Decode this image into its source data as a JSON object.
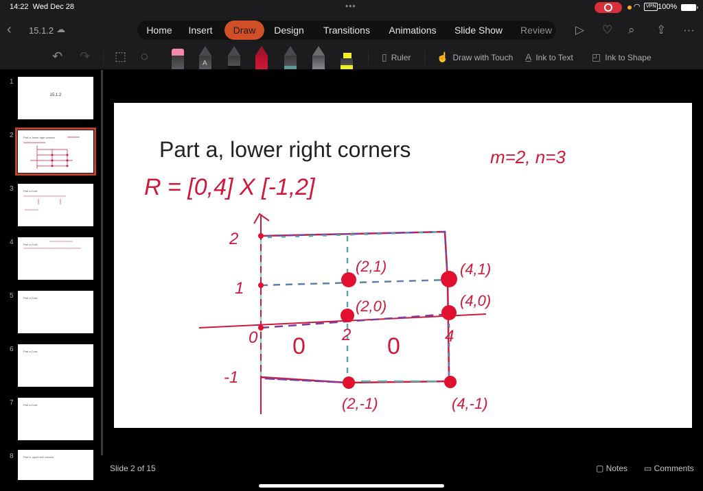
{
  "status_bar": {
    "time": "14:22",
    "date": "Wed Dec 28",
    "multitask_dots": "•••",
    "vpn_label": "VPN",
    "battery_percent": "100%"
  },
  "ribbon": {
    "document_name": "15.1.2",
    "tabs": [
      {
        "label": "Home",
        "active": false
      },
      {
        "label": "Insert",
        "active": false
      },
      {
        "label": "Draw",
        "active": true
      },
      {
        "label": "Design",
        "active": false
      },
      {
        "label": "Transitions",
        "active": false
      },
      {
        "label": "Animations",
        "active": false
      },
      {
        "label": "Slide Show",
        "active": false
      },
      {
        "label": "Review",
        "active": false
      }
    ],
    "icons": [
      "play-icon",
      "lightbulb-icon",
      "search-icon",
      "share-icon",
      "more-icon"
    ]
  },
  "draw_toolbar": {
    "pens": [
      {
        "name": "eraser",
        "color": "#f28cab"
      },
      {
        "name": "action-pen",
        "color": "#6a6a6e"
      },
      {
        "name": "black-pen",
        "color": "#111111"
      },
      {
        "name": "red-pen",
        "color": "#d0183a"
      },
      {
        "name": "teal-pen",
        "color": "#7fd0c8"
      },
      {
        "name": "gray-pencil",
        "color": "#9a9a9e"
      },
      {
        "name": "yellow-highlighter",
        "color": "#f0f020"
      }
    ],
    "ruler_label": "Ruler",
    "draw_with_touch_label": "Draw with Touch",
    "ink_to_text_label": "Ink to Text",
    "ink_to_shape_label": "Ink to Shape"
  },
  "sidebar": {
    "thumbnails": [
      {
        "number": "1",
        "title": "15.1.2",
        "active": false
      },
      {
        "number": "2",
        "title": "Part a, lower right corners",
        "active": true
      },
      {
        "number": "3",
        "title": "Part a Cont.",
        "active": false
      },
      {
        "number": "4",
        "title": "Part a Cont.",
        "active": false
      },
      {
        "number": "5",
        "title": "Part a Cont.",
        "active": false
      },
      {
        "number": "6",
        "title": "Part a Cont.",
        "active": false
      },
      {
        "number": "7",
        "title": "Part a Cont.",
        "active": false
      },
      {
        "number": "8",
        "title": "Part b, upper left corners",
        "active": false
      }
    ]
  },
  "slide": {
    "title": "Part a, lower right corners",
    "ink_region": "R = [0,4] X [-1,2]",
    "ink_params": "m=2, n=3",
    "axis_labels": {
      "y2": "2",
      "y1": "1",
      "y0": "0",
      "yneg1": "-1",
      "x2": "2",
      "x4": "4"
    },
    "point_labels": [
      "(2,1)",
      "(4,1)",
      "(2,0)",
      "(4,0)",
      "(2,-1)",
      "(4,-1)"
    ],
    "cell_values": [
      "0",
      "0"
    ],
    "ink_color": "#d0183a"
  },
  "bottom_bar": {
    "slide_indicator": "Slide 2 of 15",
    "notes_label": "Notes",
    "comments_label": "Comments"
  }
}
